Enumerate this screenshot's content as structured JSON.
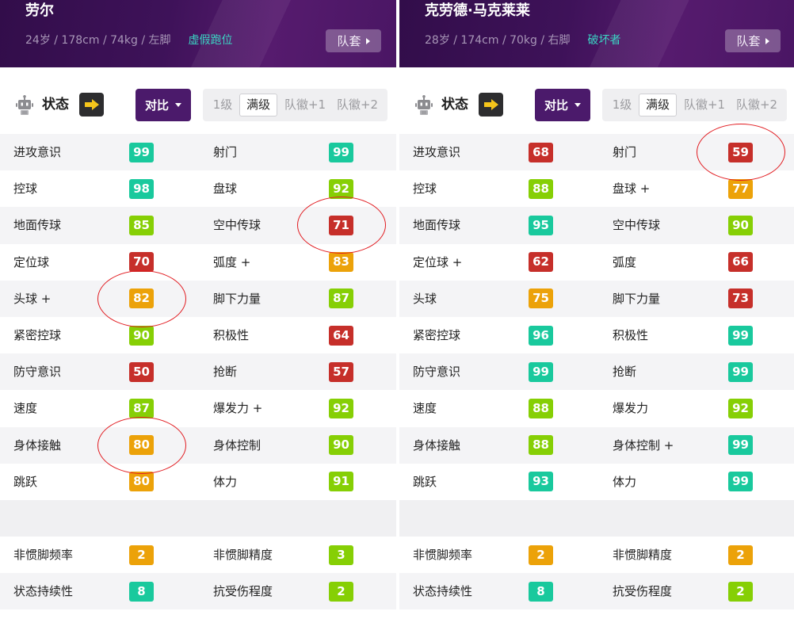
{
  "tier_colors": {
    "teal": "#19c99d",
    "green": "#86cf05",
    "orange": "#eca209",
    "red": "#c62f2a"
  },
  "accent": {
    "compare_button": "#4b1a6b",
    "playstyle_text": "#3bd6c4",
    "arrow_icon": "#f5c51b",
    "annotation_circle": "#e11a1f"
  },
  "icons": {
    "status": "robot-icon",
    "status_arrow": "arrow-right-icon",
    "compare_caret": "caret-down-icon",
    "kit_caret": "caret-right-icon"
  },
  "panels": [
    {
      "player": {
        "name": "劳尔",
        "info": "24岁 / 178cm / 74kg / 左脚",
        "playstyle": "虚假跑位",
        "kit_button": "队套"
      },
      "toolbar": {
        "status_label": "状态",
        "compare_label": "对比",
        "levels": [
          "1级",
          "满级",
          "队徽+1",
          "队徽+2"
        ],
        "selected_level": "满级"
      },
      "stats": [
        [
          {
            "label": "进攻意识",
            "value": 99,
            "tier": "teal"
          },
          {
            "label": "射门",
            "value": 99,
            "tier": "teal"
          }
        ],
        [
          {
            "label": "控球",
            "value": 98,
            "tier": "teal"
          },
          {
            "label": "盘球",
            "value": 92,
            "tier": "green"
          }
        ],
        [
          {
            "label": "地面传球",
            "value": 85,
            "tier": "green"
          },
          {
            "label": "空中传球",
            "value": 71,
            "tier": "red",
            "circled": true
          }
        ],
        [
          {
            "label": "定位球",
            "value": 70,
            "tier": "red"
          },
          {
            "label": "弧度 +",
            "value": 83,
            "tier": "orange"
          }
        ],
        [
          {
            "label": "头球 +",
            "value": 82,
            "tier": "orange",
            "circled": true
          },
          {
            "label": "脚下力量",
            "value": 87,
            "tier": "green"
          }
        ],
        [
          {
            "label": "紧密控球",
            "value": 90,
            "tier": "green"
          },
          {
            "label": "积极性",
            "value": 64,
            "tier": "red"
          }
        ],
        [
          {
            "label": "防守意识",
            "value": 50,
            "tier": "red"
          },
          {
            "label": "抢断",
            "value": 57,
            "tier": "red"
          }
        ],
        [
          {
            "label": "速度",
            "value": 87,
            "tier": "green"
          },
          {
            "label": "爆发力 +",
            "value": 92,
            "tier": "green"
          }
        ],
        [
          {
            "label": "身体接触",
            "value": 80,
            "tier": "orange",
            "circled": true
          },
          {
            "label": "身体控制",
            "value": 90,
            "tier": "green"
          }
        ],
        [
          {
            "label": "跳跃",
            "value": 80,
            "tier": "orange"
          },
          {
            "label": "体力",
            "value": 91,
            "tier": "green"
          }
        ]
      ],
      "extra_stats": [
        [
          {
            "label": "非惯脚频率",
            "value": 2,
            "tier": "orange"
          },
          {
            "label": "非惯脚精度",
            "value": 3,
            "tier": "green"
          }
        ],
        [
          {
            "label": "状态持续性",
            "value": 8,
            "tier": "teal"
          },
          {
            "label": "抗受伤程度",
            "value": 2,
            "tier": "green"
          }
        ]
      ]
    },
    {
      "player": {
        "name": "克劳德·马克莱莱",
        "info": "28岁 / 174cm / 70kg / 右脚",
        "playstyle": "破坏者",
        "kit_button": "队套"
      },
      "toolbar": {
        "status_label": "状态",
        "compare_label": "对比",
        "levels": [
          "1级",
          "满级",
          "队徽+1",
          "队徽+2"
        ],
        "selected_level": "满级"
      },
      "stats": [
        [
          {
            "label": "进攻意识",
            "value": 68,
            "tier": "red"
          },
          {
            "label": "射门",
            "value": 59,
            "tier": "red",
            "circled": true
          }
        ],
        [
          {
            "label": "控球",
            "value": 88,
            "tier": "green"
          },
          {
            "label": "盘球 +",
            "value": 77,
            "tier": "orange"
          }
        ],
        [
          {
            "label": "地面传球",
            "value": 95,
            "tier": "teal"
          },
          {
            "label": "空中传球",
            "value": 90,
            "tier": "green"
          }
        ],
        [
          {
            "label": "定位球 +",
            "value": 62,
            "tier": "red"
          },
          {
            "label": "弧度",
            "value": 66,
            "tier": "red"
          }
        ],
        [
          {
            "label": "头球",
            "value": 75,
            "tier": "orange"
          },
          {
            "label": "脚下力量",
            "value": 73,
            "tier": "red"
          }
        ],
        [
          {
            "label": "紧密控球",
            "value": 96,
            "tier": "teal"
          },
          {
            "label": "积极性",
            "value": 99,
            "tier": "teal"
          }
        ],
        [
          {
            "label": "防守意识",
            "value": 99,
            "tier": "teal"
          },
          {
            "label": "抢断",
            "value": 99,
            "tier": "teal"
          }
        ],
        [
          {
            "label": "速度",
            "value": 88,
            "tier": "green"
          },
          {
            "label": "爆发力",
            "value": 92,
            "tier": "green"
          }
        ],
        [
          {
            "label": "身体接触",
            "value": 88,
            "tier": "green"
          },
          {
            "label": "身体控制 +",
            "value": 99,
            "tier": "teal"
          }
        ],
        [
          {
            "label": "跳跃",
            "value": 93,
            "tier": "teal"
          },
          {
            "label": "体力",
            "value": 99,
            "tier": "teal"
          }
        ]
      ],
      "extra_stats": [
        [
          {
            "label": "非惯脚频率",
            "value": 2,
            "tier": "orange"
          },
          {
            "label": "非惯脚精度",
            "value": 2,
            "tier": "orange"
          }
        ],
        [
          {
            "label": "状态持续性",
            "value": 8,
            "tier": "teal"
          },
          {
            "label": "抗受伤程度",
            "value": 2,
            "tier": "green"
          }
        ]
      ]
    }
  ]
}
